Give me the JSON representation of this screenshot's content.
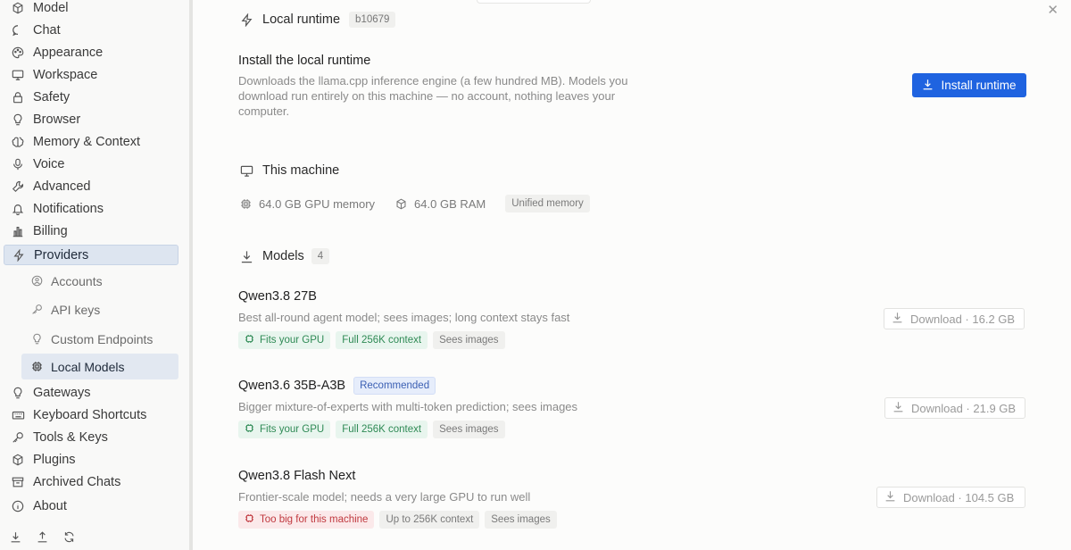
{
  "sidebar": {
    "items": [
      {
        "label": "Model",
        "icon": "cube-icon"
      },
      {
        "label": "Chat",
        "icon": "chat-icon"
      },
      {
        "label": "Appearance",
        "icon": "palette-icon"
      },
      {
        "label": "Workspace",
        "icon": "monitor-icon"
      },
      {
        "label": "Safety",
        "icon": "lock-icon"
      },
      {
        "label": "Browser",
        "icon": "bulb-icon"
      },
      {
        "label": "Memory & Context",
        "icon": "brain-icon"
      },
      {
        "label": "Voice",
        "icon": "mic-icon"
      },
      {
        "label": "Advanced",
        "icon": "wrench-icon"
      },
      {
        "label": "Notifications",
        "icon": "bell-icon"
      },
      {
        "label": "Billing",
        "icon": "bar-chart-icon"
      },
      {
        "label": "Providers",
        "icon": "bolt-icon"
      }
    ],
    "sub_items": [
      {
        "label": "Accounts",
        "icon": "account-icon"
      },
      {
        "label": "API keys",
        "icon": "key-icon"
      },
      {
        "label": "Custom Endpoints",
        "icon": "bulb-icon"
      },
      {
        "label": "Local Models",
        "icon": "chip-icon"
      }
    ],
    "items_after": [
      {
        "label": "Gateways",
        "icon": "bulb-icon"
      },
      {
        "label": "Keyboard Shortcuts",
        "icon": "keyboard-icon"
      },
      {
        "label": "Tools & Keys",
        "icon": "key-icon"
      },
      {
        "label": "Plugins",
        "icon": "cube-icon"
      },
      {
        "label": "Archived Chats",
        "icon": "archive-icon"
      },
      {
        "label": "About",
        "icon": "info-icon"
      }
    ]
  },
  "runtime": {
    "title": "Local runtime",
    "version": "b10679",
    "install_title": "Install the local runtime",
    "install_desc_1": "Downloads the llama.cpp inference engine (a few hundred MB). Models you",
    "install_desc_2": "download run entirely on this machine — no account, nothing leaves your",
    "install_desc_3": "computer.",
    "install_button": "Install runtime"
  },
  "machine": {
    "title": "This machine",
    "gpu": "64.0 GB GPU memory",
    "ram": "64.0 GB RAM",
    "tag": "Unified memory"
  },
  "models": {
    "title": "Models",
    "count": "4",
    "list": [
      {
        "name": "Qwen3.8 27B",
        "badge": "",
        "desc": "Best all-round agent model; sees images; long context stays fast",
        "tag1": "Fits your GPU",
        "tag2": "Full 256K context",
        "tag3": "Sees images",
        "button": "Download · 16.2 GB"
      },
      {
        "name": "Qwen3.6 35B-A3B",
        "badge": "Recommended",
        "desc": "Bigger mixture-of-experts with multi-token prediction; sees images",
        "tag1": "Fits your GPU",
        "tag2": "Full 256K context",
        "tag3": "Sees images",
        "button": "Download · 21.9 GB"
      },
      {
        "name": "Qwen3.8 Flash Next",
        "badge": "",
        "desc": "Frontier-scale model; needs a very large GPU to run well",
        "tag1": "Too big for this machine",
        "tag2": "Up to 256K context",
        "tag3": "Sees images",
        "button": "Download · 104.5 GB"
      }
    ]
  },
  "colors": {
    "accent": "#1f63e0",
    "green": "#2f8a55",
    "red": "#c0393f"
  }
}
